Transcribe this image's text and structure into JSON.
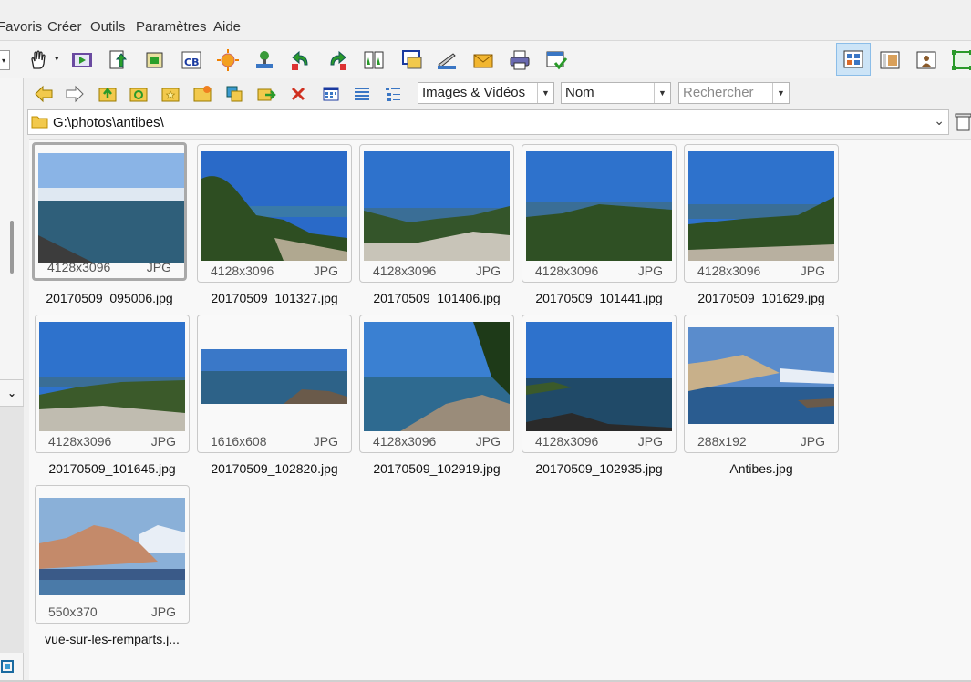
{
  "menu": {
    "favoris": "Favoris",
    "creer": "Créer",
    "outils": "Outils",
    "parametres": "Paramètres",
    "aide": "Aide"
  },
  "toolbar2": {
    "filter_value": "Images & Vidéos",
    "sort_value": "Nom",
    "search_placeholder": "Rechercher"
  },
  "path": "G:\\photos\\antibes\\",
  "thumbnails": [
    {
      "name": "20170509_095006.jpg",
      "dims": "4128x3096",
      "fmt": "JPG",
      "selected": true
    },
    {
      "name": "20170509_101327.jpg",
      "dims": "4128x3096",
      "fmt": "JPG"
    },
    {
      "name": "20170509_101406.jpg",
      "dims": "4128x3096",
      "fmt": "JPG"
    },
    {
      "name": "20170509_101441.jpg",
      "dims": "4128x3096",
      "fmt": "JPG"
    },
    {
      "name": "20170509_101629.jpg",
      "dims": "4128x3096",
      "fmt": "JPG"
    },
    {
      "name": "20170509_101645.jpg",
      "dims": "4128x3096",
      "fmt": "JPG"
    },
    {
      "name": "20170509_102820.jpg",
      "dims": "1616x608",
      "fmt": "JPG"
    },
    {
      "name": "20170509_102919.jpg",
      "dims": "4128x3096",
      "fmt": "JPG"
    },
    {
      "name": "20170509_102935.jpg",
      "dims": "4128x3096",
      "fmt": "JPG"
    },
    {
      "name": "Antibes.jpg",
      "dims": "288x192",
      "fmt": "JPG"
    },
    {
      "name": "vue-sur-les-remparts.j...",
      "dims": "550x370",
      "fmt": "JPG"
    }
  ],
  "colors": {
    "accent": "#3a76c4",
    "selection_border": "#a9a9a9"
  }
}
